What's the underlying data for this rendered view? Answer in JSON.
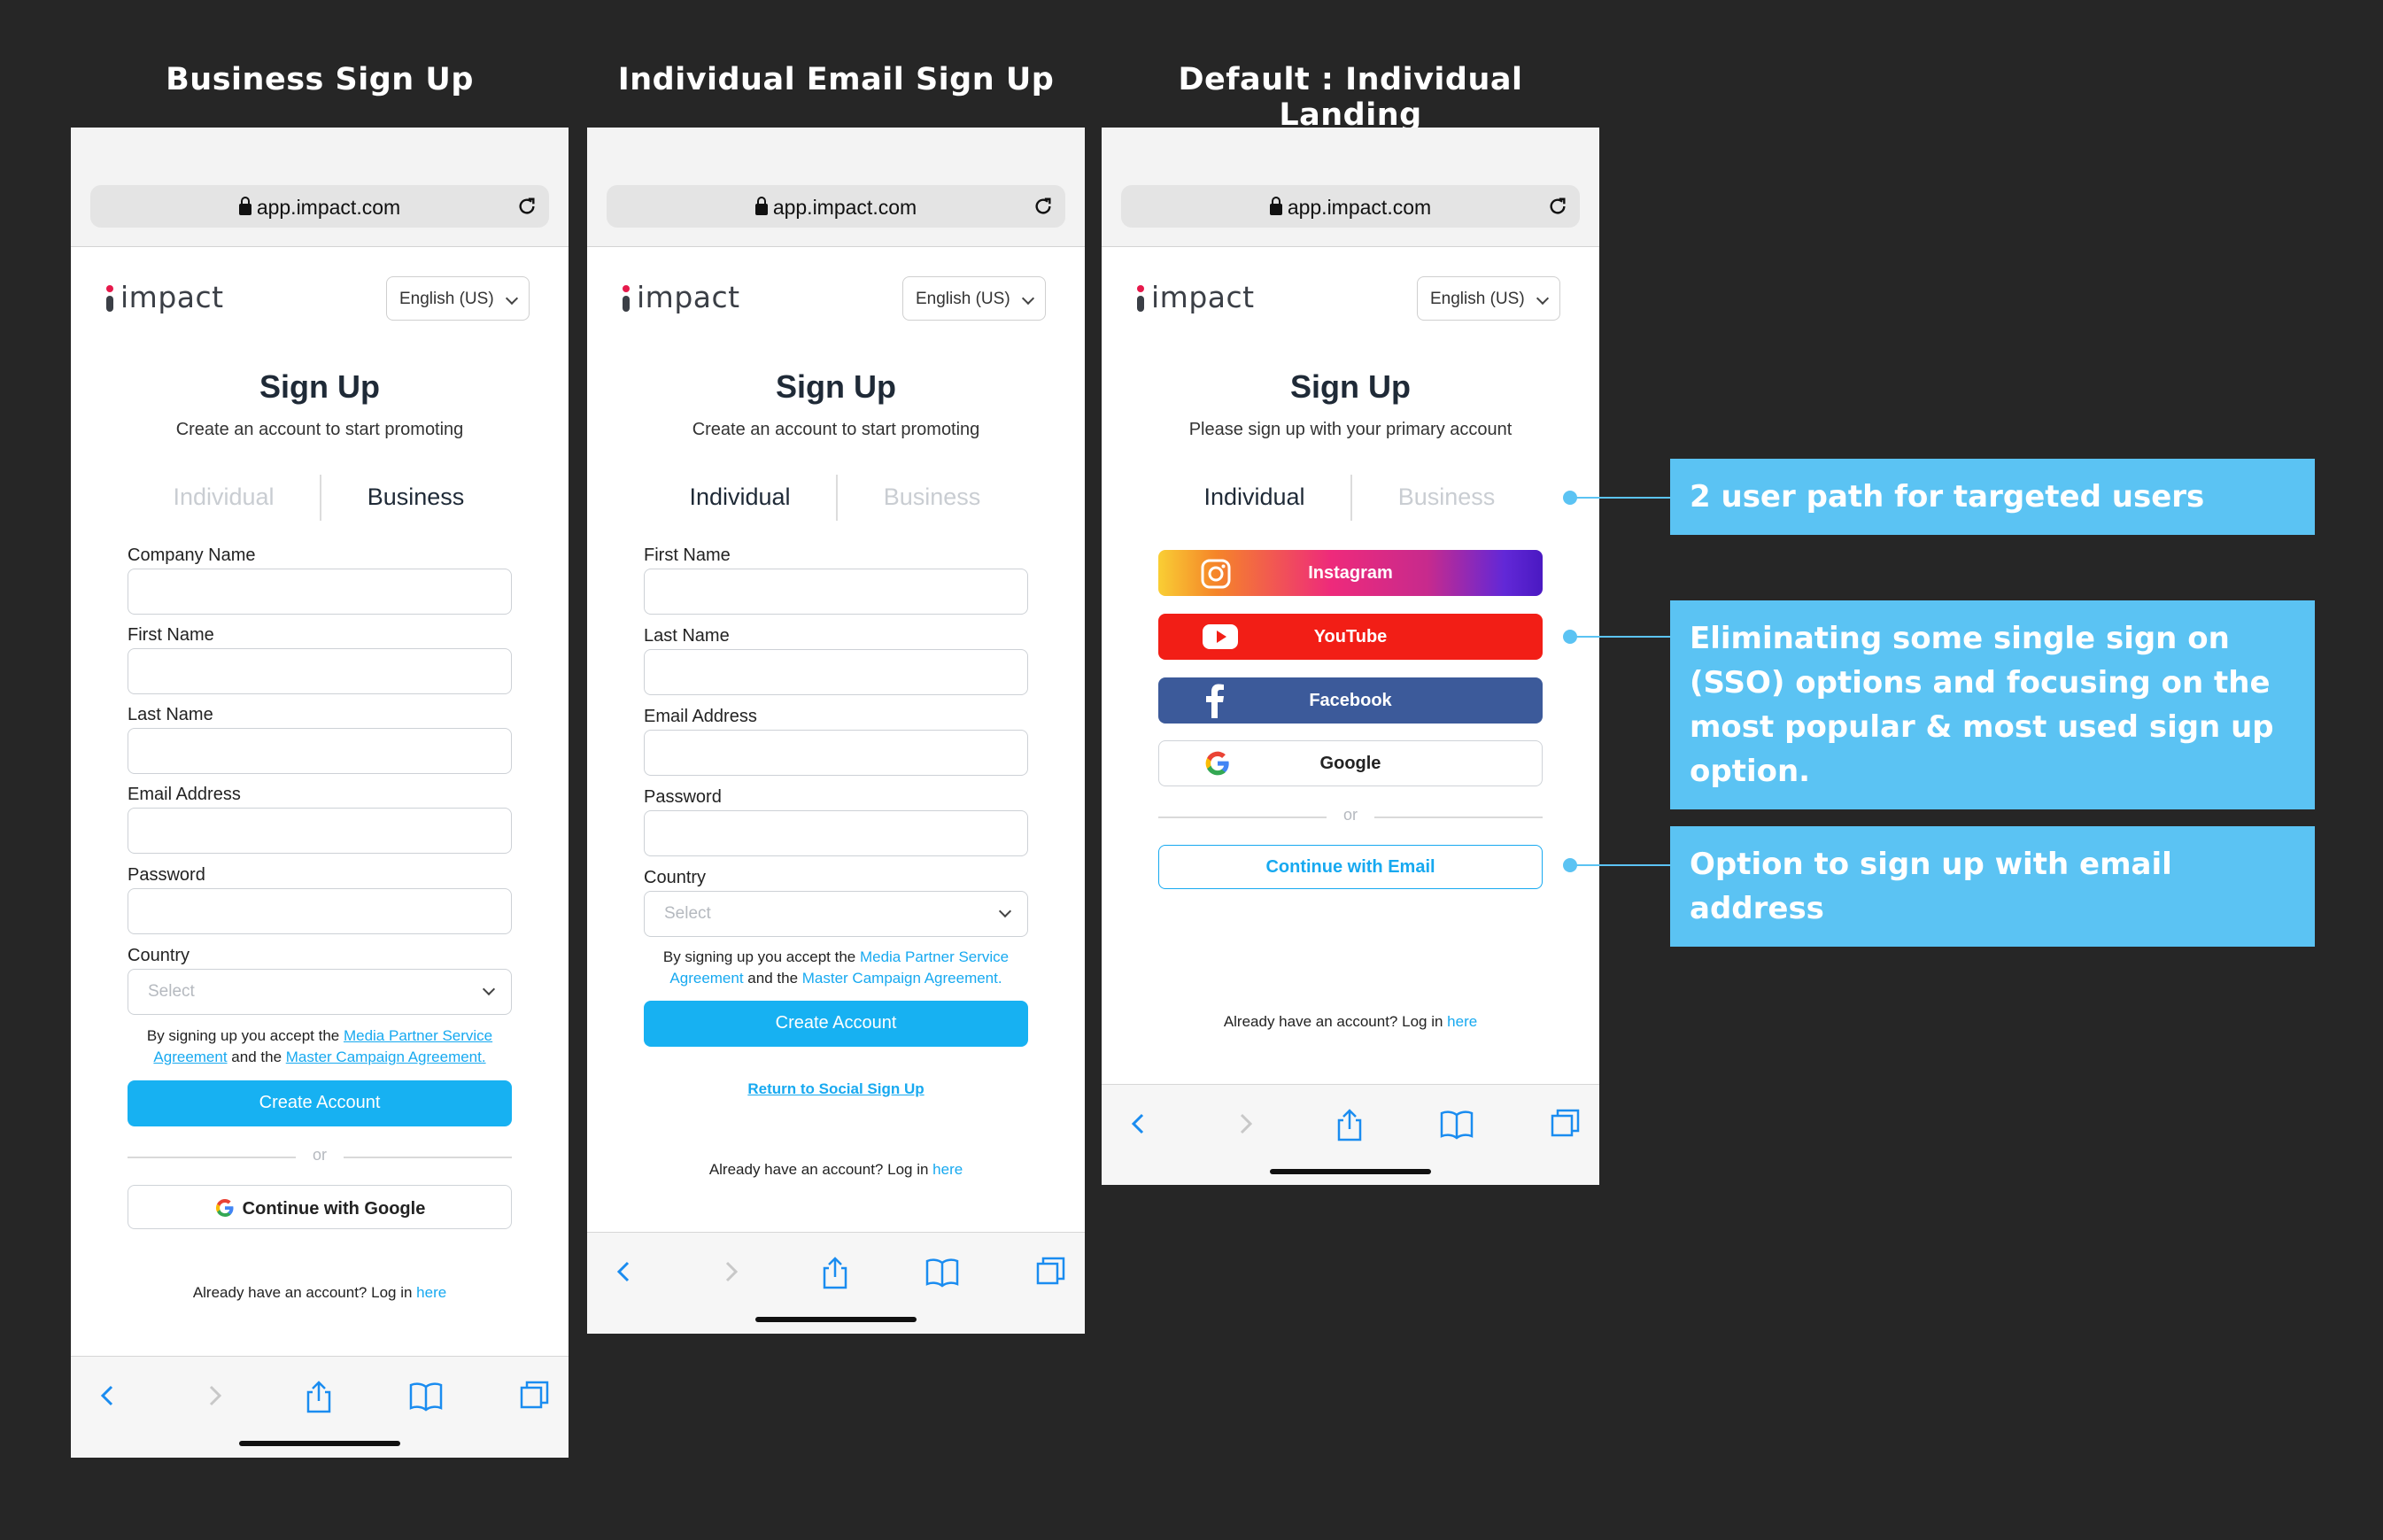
{
  "columns": [
    {
      "title": "Business Sign Up"
    },
    {
      "title": "Individual Email Sign Up"
    },
    {
      "title": "Default : Individual Landing"
    }
  ],
  "browser": {
    "url": "app.impact.com"
  },
  "brand": {
    "logo_text": "impact",
    "accent": "#17b1f2",
    "logo_dot": "#e6194b"
  },
  "language_select": {
    "value": "English (US)"
  },
  "signup": {
    "title": "Sign Up",
    "subtitle_promote": "Create an account to start promoting",
    "subtitle_primary": "Please sign up with your primary account"
  },
  "tabs": {
    "individual": "Individual",
    "business": "Business"
  },
  "fields": {
    "company_name": "Company Name",
    "first_name": "First Name",
    "last_name": "Last Name",
    "email": "Email Address",
    "password": "Password",
    "country": "Country",
    "country_placeholder": "Select"
  },
  "terms": {
    "prefix": "By signing up you accept the ",
    "link1": "Media Partner Service Agreement",
    "mid": " and the ",
    "link2": "Master Campaign Agreement."
  },
  "buttons": {
    "create_account": "Create Account",
    "or": "or",
    "continue_google": "Continue with Google",
    "return_social": "Return to Social Sign Up",
    "instagram": "Instagram",
    "youtube": "YouTube",
    "facebook": "Facebook",
    "google": "Google",
    "continue_email": "Continue with Email"
  },
  "login": {
    "prefix": "Already have an account? Log in ",
    "link": "here"
  },
  "annotations": [
    {
      "text": "2 user path for targeted users"
    },
    {
      "text": "Eliminating some single sign on (SSO) options and focusing on the most popular & most used sign up option."
    },
    {
      "text": "Option to sign up with email address"
    }
  ],
  "icons": [
    "lock-icon",
    "reload-icon",
    "back-icon",
    "forward-icon",
    "share-icon",
    "bookmarks-icon",
    "tabs-icon",
    "google-icon",
    "instagram-icon",
    "youtube-icon",
    "facebook-icon"
  ]
}
